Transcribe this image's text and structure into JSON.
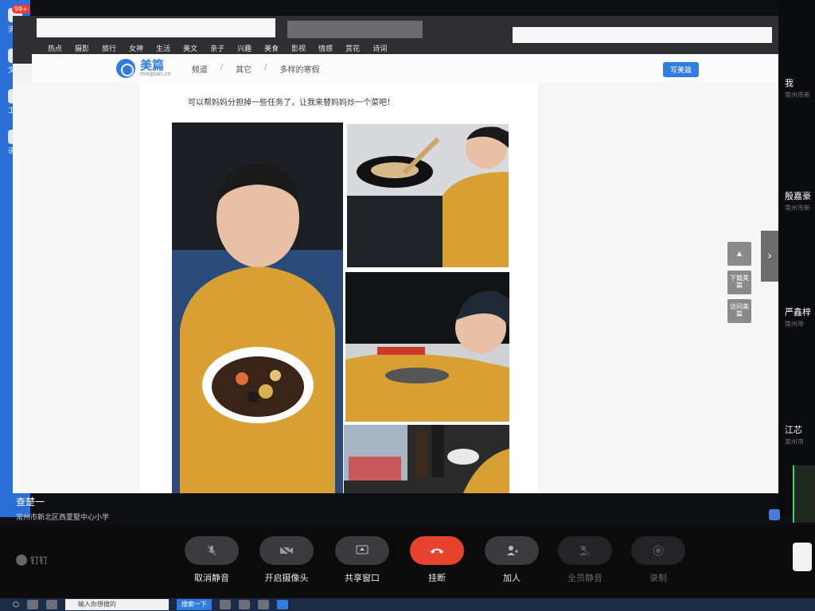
{
  "left_rail": {
    "items": [
      {
        "label": "消息",
        "badge": "99+"
      },
      {
        "label": "文档"
      },
      {
        "label": "工作"
      },
      {
        "label": "讯录"
      }
    ]
  },
  "browser": {
    "categories": [
      "热点",
      "摄影",
      "旅行",
      "女神",
      "生活",
      "美文",
      "亲子",
      "兴趣",
      "美食",
      "影视",
      "情感",
      "赏花",
      "诗词"
    ],
    "logo_cn": "美篇",
    "logo_en": "meipian.cn",
    "breadcrumbs": [
      "频道",
      "其它",
      "多样的寒假"
    ],
    "breadcrumb_sep": "/",
    "write_button": "写美篇",
    "article_text": "可以帮妈妈分担掉一些任务了，让我来替妈妈炒一个菜吧！",
    "side_buttons": [
      "下载美篇",
      "访问美篇"
    ]
  },
  "participants": [
    {
      "name": "我",
      "sub": "常州市新"
    },
    {
      "name": "殷嘉豪",
      "sub": "常州市新"
    },
    {
      "name": "严鑫梓",
      "sub": "常州市"
    },
    {
      "name": "江芯",
      "sub": "常州市"
    }
  ],
  "presenter": {
    "name": "查楚一",
    "school": "常州市新北区西夏墅中心小学"
  },
  "controls": {
    "dingding": "钉钉",
    "buttons": [
      {
        "label": "取消静音"
      },
      {
        "label": "开启摄像头"
      },
      {
        "label": "共享窗口"
      },
      {
        "label": "挂断"
      },
      {
        "label": "加人"
      },
      {
        "label": "全员静音"
      },
      {
        "label": "录制"
      }
    ]
  },
  "taskbar": {
    "search_placeholder": "输入你想搜的",
    "search_button": "搜索一下"
  }
}
